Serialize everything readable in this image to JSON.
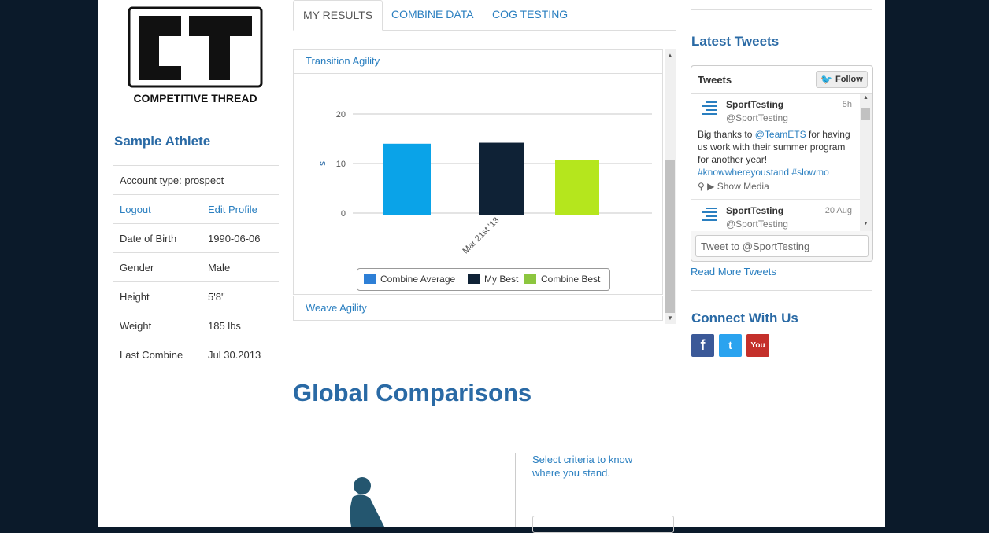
{
  "brand": {
    "name": "COMPETITIVE THREAD",
    "mark": "CT"
  },
  "athlete": {
    "name": "Sample Athlete",
    "account_type": "Account type: prospect",
    "logout": "Logout",
    "edit_profile": "Edit Profile",
    "fields": [
      {
        "label": "Date of Birth",
        "value": "1990-06-06"
      },
      {
        "label": "Gender",
        "value": "Male"
      },
      {
        "label": "Height",
        "value": "5'8\""
      },
      {
        "label": "Weight",
        "value": "185 lbs"
      },
      {
        "label": "Last Combine",
        "value": "Jul 30.2013"
      }
    ]
  },
  "tabs": [
    "MY RESULTS",
    "COMBINE DATA",
    "COG TESTING"
  ],
  "accordion": {
    "open_section": "Transition Agility",
    "closed_section": "Weave Agility"
  },
  "chart_data": {
    "type": "bar",
    "categories": [
      "Mar 21st '13"
    ],
    "series": [
      {
        "name": "Combine Average",
        "values": [
          14
        ],
        "color": "#0aa3e8"
      },
      {
        "name": "My Best",
        "values": [
          14.2
        ],
        "color": "#0f2236"
      },
      {
        "name": "Combine Best",
        "values": [
          10.7
        ],
        "color": "#b5e61d"
      }
    ],
    "ylabel": "s",
    "ylim": [
      0,
      20
    ],
    "yticks": [
      "0",
      "10",
      "20"
    ],
    "legend_placement": "bottom",
    "grid": true
  },
  "global": {
    "title": "Global Comparisons",
    "criteria": "Select criteria to know where you stand."
  },
  "sidebar": {
    "latest_tweets": "Latest Tweets",
    "widget": {
      "title": "Tweets",
      "follow": "Follow",
      "tweets": [
        {
          "name": "SportTesting",
          "handle": "@SportTesting",
          "time": "5h",
          "text_pre": "Big thanks to ",
          "mention": "@TeamETS",
          "text_post": " for having us work with their summer program for another year!",
          "hashtags": "#knowwhereyoustand #slowmo",
          "media": "Show Media"
        },
        {
          "name": "SportTesting",
          "handle": "@SportTesting",
          "time": "20 Aug"
        }
      ],
      "input_placeholder": "Tweet to @SportTesting"
    },
    "read_more": "Read More Tweets",
    "connect": "Connect With Us",
    "social": [
      {
        "icon": "facebook-icon",
        "glyph": "f",
        "color": "#3b5998"
      },
      {
        "icon": "twitter-icon",
        "glyph": "t",
        "color": "#2aa3ef"
      },
      {
        "icon": "youtube-icon",
        "glyph": "You",
        "color": "#c4302b"
      }
    ]
  }
}
